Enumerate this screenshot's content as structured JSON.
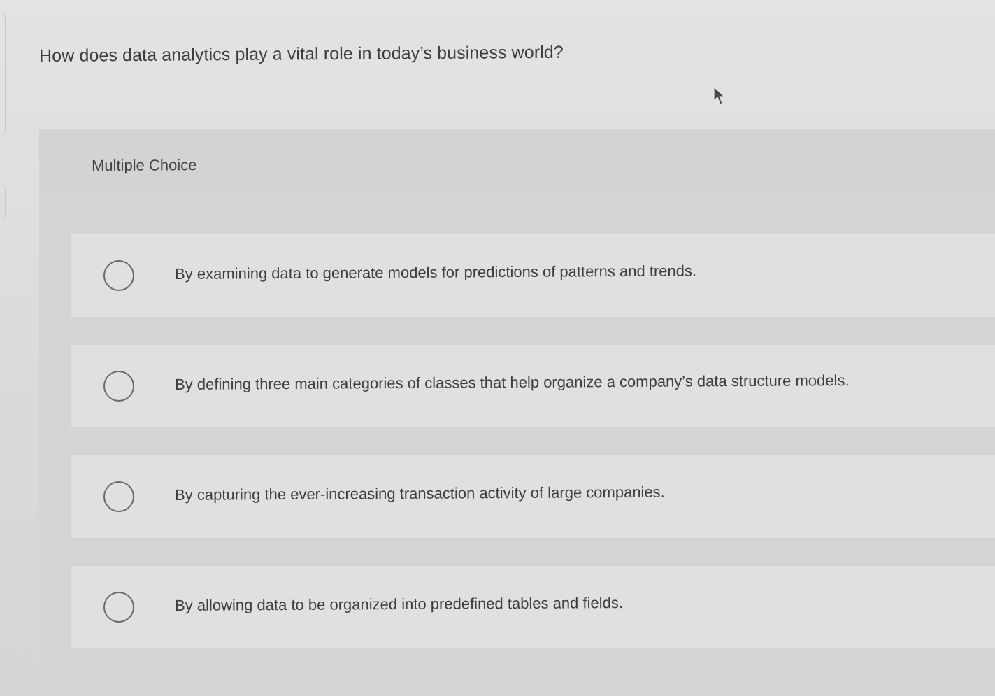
{
  "question": {
    "text": "How does data analytics play a vital role in today’s business world?"
  },
  "question_type": {
    "label": "Multiple Choice"
  },
  "options": [
    {
      "label": "By examining data to generate models for predictions of patterns and trends."
    },
    {
      "label": "By defining three main categories of classes that help organize a company’s data structure models."
    },
    {
      "label": "By capturing the ever-increasing transaction activity of large companies."
    },
    {
      "label": "By allowing data to be organized into predefined tables and fields."
    }
  ],
  "icons": {
    "cursor": "mouse-pointer-icon",
    "radio": "radio-unselected-icon"
  },
  "colors": {
    "text": "#3e3e3e",
    "panel": "#d4d4d4",
    "option_bg": "#e0e0e0",
    "radio_border": "#6a6a6a"
  }
}
